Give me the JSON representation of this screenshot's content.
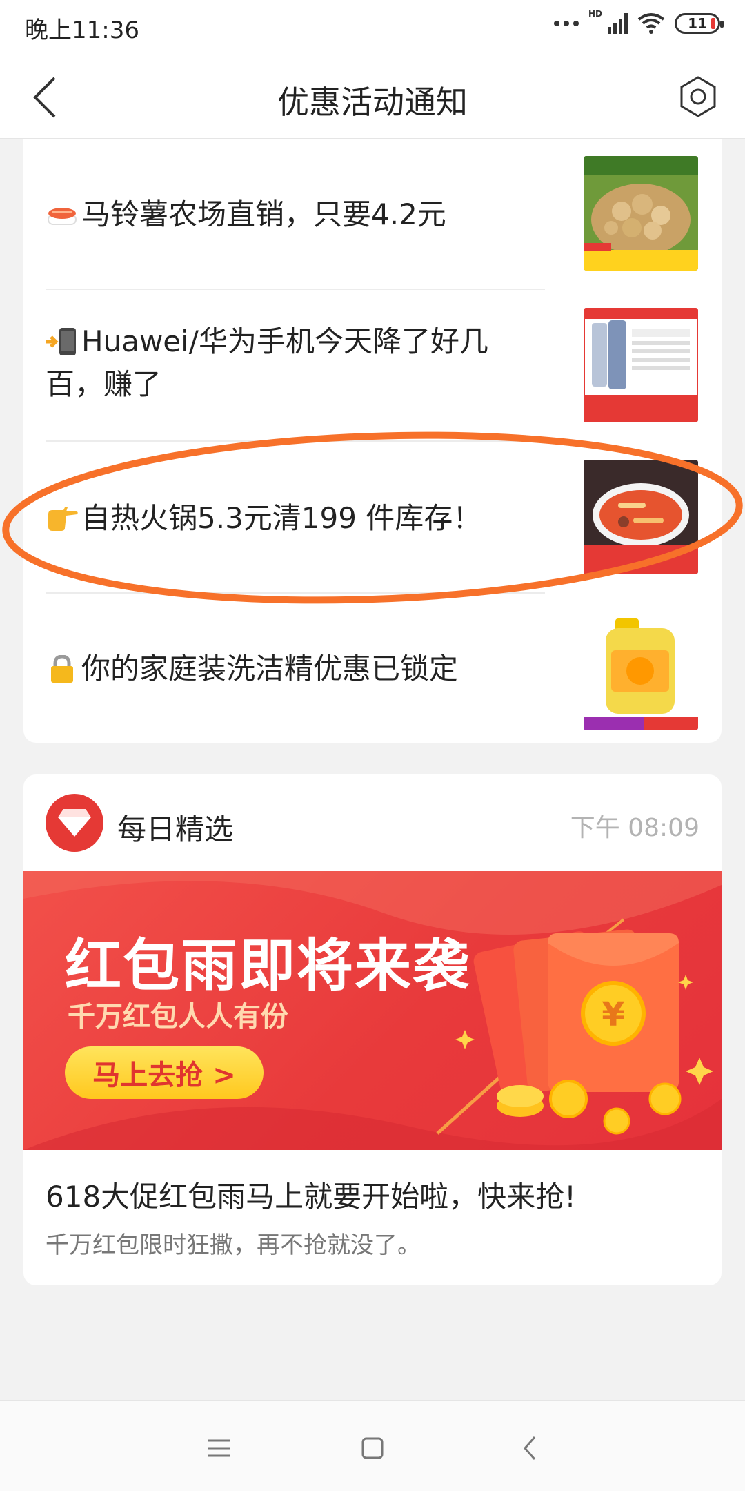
{
  "status_bar": {
    "time": "晚上11:36",
    "network_badge": "HD",
    "battery": "11"
  },
  "nav": {
    "title": "优惠活动通知",
    "back_icon": "chevron-left-icon",
    "settings_icon": "gear-icon"
  },
  "promotions": [
    {
      "emoji": "sushi-emoji",
      "text": "马铃薯农场直销，只要4.2元",
      "thumb": "potato-photo"
    },
    {
      "emoji": "phone-arrow-emoji",
      "text": "Huawei/华为手机今天降了好几百，赚了",
      "thumb": "phone-photo"
    },
    {
      "emoji": "point-right-emoji",
      "text": "自热火锅5.3元清199 件库存！",
      "thumb": "hotpot-photo",
      "highlighted": true
    },
    {
      "emoji": "lock-emoji",
      "text": "你的家庭装洗洁精优惠已锁定",
      "thumb": "detergent-photo"
    }
  ],
  "daily": {
    "title": "每日精选",
    "time": "下午 08:09",
    "banner": {
      "title": "红包雨即将来袭",
      "subtitle": "千万红包人人有份",
      "button": "马上去抢 >"
    },
    "headline": "618大促红包雨马上就要开始啦，快来抢!",
    "description": "千万红包限时狂撒，再不抢就没了。"
  },
  "colors": {
    "accent_red": "#e53935",
    "highlight_orange": "#f7712a",
    "banner_yellow": "#ffd23a"
  }
}
